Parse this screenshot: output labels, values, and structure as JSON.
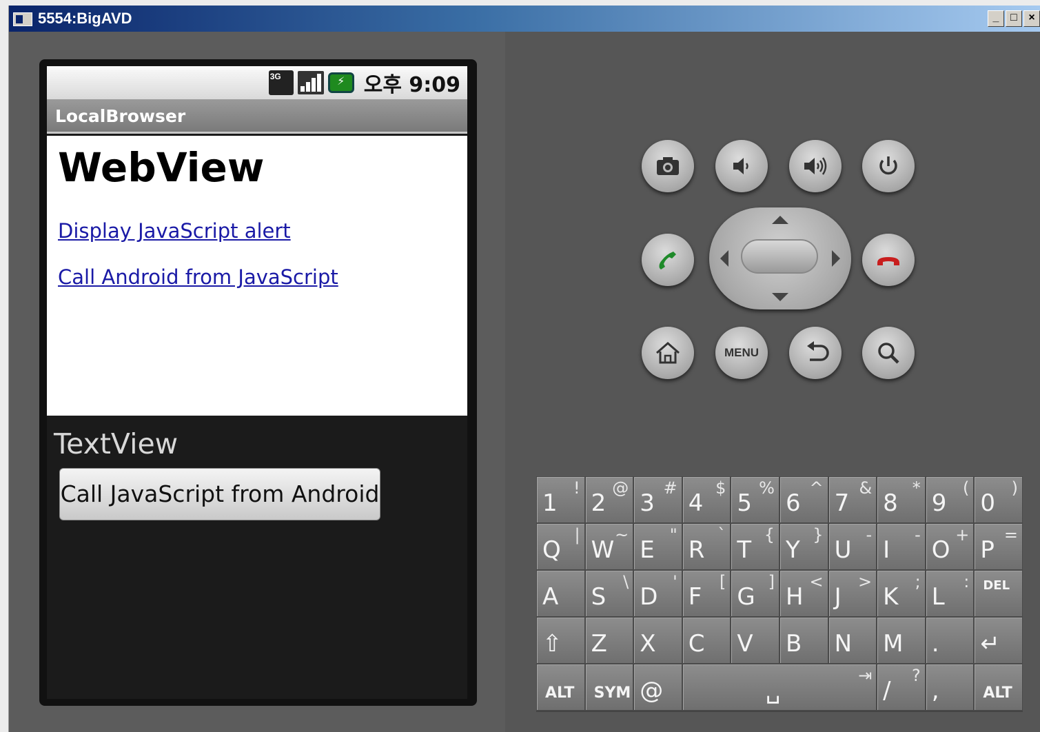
{
  "window": {
    "title": "5554:BigAVD",
    "controls": [
      "_",
      "□",
      "×"
    ]
  },
  "status_bar": {
    "net": "3G",
    "battery_icon": "battery-charging-icon",
    "time": "오후 9:09"
  },
  "app": {
    "title": "LocalBrowser",
    "webview_heading": "WebView",
    "links": [
      "Display JavaScript alert",
      "Call Android from JavaScript"
    ],
    "textview": "TextView",
    "button_label": "Call JavaScript from Android"
  },
  "hardware": {
    "row1": [
      "camera-icon",
      "volume-down-icon",
      "volume-up-icon",
      "power-icon"
    ],
    "menu_label": "MENU",
    "call_color": "#1f8a2a",
    "end_color": "#c81e1e"
  },
  "keyboard": {
    "row1": [
      [
        "1",
        "!"
      ],
      [
        "2",
        "@"
      ],
      [
        "3",
        "#"
      ],
      [
        "4",
        "$"
      ],
      [
        "5",
        "%"
      ],
      [
        "6",
        "^"
      ],
      [
        "7",
        "&"
      ],
      [
        "8",
        "*"
      ],
      [
        "9",
        "("
      ],
      [
        "0",
        ")"
      ]
    ],
    "row2": [
      [
        "Q",
        "|"
      ],
      [
        "W",
        "~"
      ],
      [
        "E",
        "\""
      ],
      [
        "R",
        "`"
      ],
      [
        "T",
        "{"
      ],
      [
        "Y",
        "}"
      ],
      [
        "U",
        "-"
      ],
      [
        "I",
        "-"
      ],
      [
        "O",
        "+"
      ],
      [
        "P",
        "="
      ]
    ],
    "row3": [
      [
        "A",
        ""
      ],
      [
        "S",
        "\\"
      ],
      [
        "D",
        "'"
      ],
      [
        "F",
        "["
      ],
      [
        "G",
        "]"
      ],
      [
        "H",
        "<"
      ],
      [
        "J",
        ">"
      ],
      [
        "K",
        ";"
      ],
      [
        "L",
        ":"
      ]
    ],
    "del_label": "DEL",
    "row4": [
      [
        "Z",
        ""
      ],
      [
        "X",
        ""
      ],
      [
        "C",
        ""
      ],
      [
        "V",
        ""
      ],
      [
        "B",
        ""
      ],
      [
        "N",
        ""
      ],
      [
        "M",
        ""
      ],
      [
        ".",
        ""
      ]
    ],
    "alt_label": "ALT",
    "sym_label": "SYM",
    "at_label": "@",
    "slash": [
      "/",
      "?"
    ],
    "comma": ","
  }
}
